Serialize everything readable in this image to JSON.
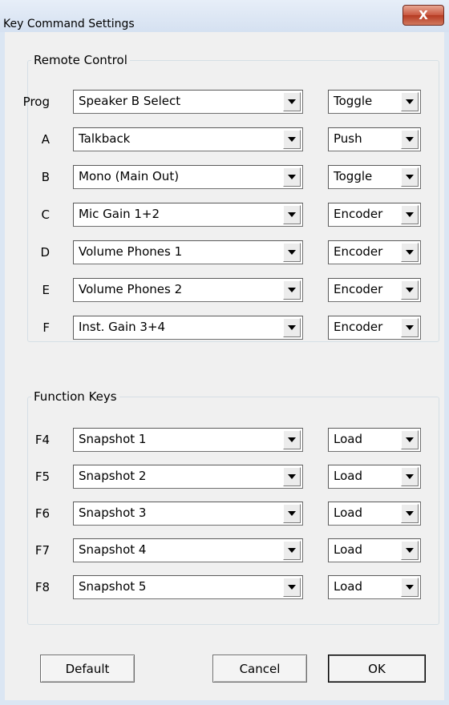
{
  "window": {
    "title": "Key Command Settings",
    "close_label": "X"
  },
  "remote_control": {
    "label": "Remote Control",
    "rows": [
      {
        "key": "Prog",
        "command": "Speaker B Select",
        "mode": "Toggle"
      },
      {
        "key": "A",
        "command": "Talkback",
        "mode": "Push"
      },
      {
        "key": "B",
        "command": "Mono (Main Out)",
        "mode": "Toggle"
      },
      {
        "key": "C",
        "command": "Mic Gain 1+2",
        "mode": "Encoder"
      },
      {
        "key": "D",
        "command": "Volume Phones 1",
        "mode": "Encoder"
      },
      {
        "key": "E",
        "command": "Volume Phones 2",
        "mode": "Encoder"
      },
      {
        "key": "F",
        "command": "Inst. Gain 3+4",
        "mode": "Encoder"
      }
    ]
  },
  "function_keys": {
    "label": "Function Keys",
    "rows": [
      {
        "key": "F4",
        "command": "Snapshot 1",
        "mode": "Load"
      },
      {
        "key": "F5",
        "command": "Snapshot 2",
        "mode": "Load"
      },
      {
        "key": "F6",
        "command": "Snapshot 3",
        "mode": "Load"
      },
      {
        "key": "F7",
        "command": "Snapshot 4",
        "mode": "Load"
      },
      {
        "key": "F8",
        "command": "Snapshot 5",
        "mode": "Load"
      }
    ]
  },
  "buttons": {
    "default": "Default",
    "cancel": "Cancel",
    "ok": "OK"
  }
}
